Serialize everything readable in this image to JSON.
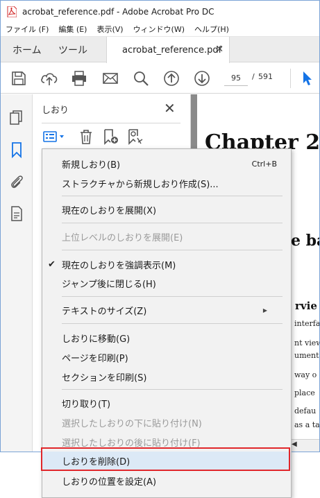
{
  "window": {
    "title": "acrobat_reference.pdf - Adobe Acrobat Pro DC"
  },
  "menubar": [
    "ファイル (F)",
    "編集 (E)",
    "表示(V)",
    "ウィンドウ(W)",
    "ヘルプ(H)"
  ],
  "tabs": {
    "home": "ホーム",
    "tools": "ツール",
    "document": "acrobat_reference.pdf",
    "close_glyph": "✕"
  },
  "toolbar": {
    "page_current": "95",
    "page_separator": "/",
    "page_total": "591",
    "icons": [
      "save-icon",
      "upload-icon",
      "print-icon",
      "mail-icon",
      "search-icon",
      "page-up-icon",
      "page-down-icon",
      "select-cursor-icon"
    ]
  },
  "rail": {
    "icons": [
      "pages-icon",
      "bookmark-icon",
      "attachment-icon",
      "document-icon"
    ]
  },
  "panel": {
    "title": "しおり",
    "close_glyph": "✕",
    "tools": [
      "options-icon",
      "trash-icon",
      "new-bookmark-icon",
      "bookmark-search-icon"
    ]
  },
  "document": {
    "heading1": "Chapter 2:",
    "heading2": "e ba",
    "heading3": "rvie",
    "lines": [
      "interfac",
      "nt view",
      "ument",
      "way o",
      "place",
      "defau",
      "as a ta"
    ]
  },
  "context_menu": {
    "items": [
      {
        "label": "新規しおり(B)",
        "shortcut": "Ctrl+B",
        "disabled": false
      },
      {
        "label": "ストラクチャから新規しおり作成(S)...",
        "disabled": false
      },
      {
        "label": "現在のしおりを展開(X)",
        "disabled": false
      },
      {
        "label": "上位レベルのしおりを展開(E)",
        "disabled": true
      },
      {
        "label": "現在のしおりを強調表示(M)",
        "checked": true,
        "disabled": false
      },
      {
        "label": "ジャンプ後に閉じる(H)",
        "disabled": false
      },
      {
        "label": "テキストのサイズ(Z)",
        "submenu": true,
        "disabled": false
      },
      {
        "label": "しおりに移動(G)",
        "disabled": false
      },
      {
        "label": "ページを印刷(P)",
        "disabled": false
      },
      {
        "label": "セクションを印刷(S)",
        "disabled": false
      },
      {
        "label": "切り取り(T)",
        "disabled": false
      },
      {
        "label": "選択したしおりの下に貼り付け(N)",
        "disabled": true
      },
      {
        "label": "選択したしおりの後に貼り付け(F)",
        "disabled": true
      },
      {
        "label": "しおりを削除(D)",
        "disabled": false,
        "highlighted": true
      },
      {
        "label": "しおりの位置を設定(A)",
        "disabled": false
      }
    ],
    "check_glyph": "✔",
    "submenu_glyph": "▶"
  },
  "colors": {
    "accent": "#1473e6",
    "highlight_border": "#e0262a",
    "hover": "#dce9f6"
  }
}
